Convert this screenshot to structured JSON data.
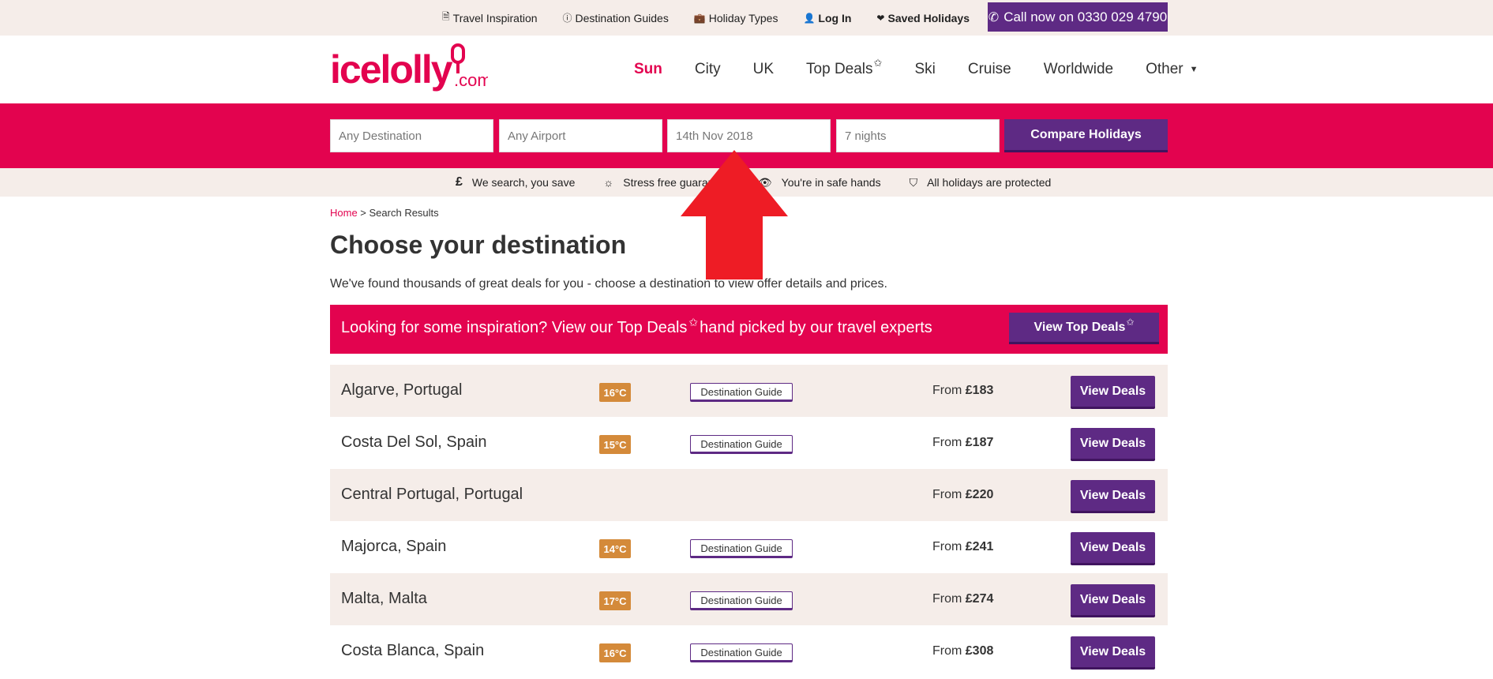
{
  "utility": {
    "links": [
      {
        "icon": "document-icon",
        "glyph": "🗎",
        "label": "Travel Inspiration"
      },
      {
        "icon": "info-icon",
        "glyph": "ⓘ",
        "label": "Destination Guides"
      },
      {
        "icon": "suitcase-icon",
        "glyph": "💼",
        "label": "Holiday Types"
      },
      {
        "icon": "user-icon",
        "glyph": "👤",
        "label": "Log In"
      },
      {
        "icon": "heart-icon",
        "glyph": "❤",
        "label": "Saved Holidays"
      }
    ],
    "call": "Call now on 0330 029 4790"
  },
  "logo": {
    "text": "icelolly",
    "suffix": ".com"
  },
  "nav": {
    "sun": "Sun",
    "city": "City",
    "uk": "UK",
    "top_deals": "Top Deals",
    "ski": "Ski",
    "cruise": "Cruise",
    "worldwide": "Worldwide",
    "other": "Other"
  },
  "search": {
    "destination": "Any Destination",
    "airport": "Any Airport",
    "date": "14th Nov 2018",
    "nights": "7 nights",
    "compare": "Compare Holidays"
  },
  "trust": [
    {
      "icon": "pound-icon",
      "glyph": "£",
      "label": "We search, you save"
    },
    {
      "icon": "sun-icon",
      "glyph": "☼",
      "label": "Stress free guarantee"
    },
    {
      "icon": "eye-icon",
      "glyph": "👁",
      "label": "You're in safe hands"
    },
    {
      "icon": "shield-icon",
      "glyph": "⛉",
      "label": "All holidays are protected"
    }
  ],
  "breadcrumb": {
    "home": "Home",
    "sep": " > ",
    "current": "Search Results"
  },
  "page": {
    "title": "Choose your destination",
    "intro": "We've found thousands of great deals for you - choose a destination to view offer details and prices."
  },
  "promo": {
    "text_before": "Looking for some inspiration? View our Top Deals",
    "text_after": "hand picked by our travel experts",
    "button": "View Top Deals"
  },
  "results": {
    "from_label": "From",
    "guide_label": "Destination Guide",
    "view_label": "View Deals",
    "rows": [
      {
        "destination": "Algarve, Portugal",
        "temp": "16°C",
        "price": "£183",
        "guide": true
      },
      {
        "destination": "Costa Del Sol, Spain",
        "temp": "15°C",
        "price": "£187",
        "guide": true
      },
      {
        "destination": "Central Portugal, Portugal",
        "temp": "",
        "price": "£220",
        "guide": false
      },
      {
        "destination": "Majorca, Spain",
        "temp": "14°C",
        "price": "£241",
        "guide": true
      },
      {
        "destination": "Malta, Malta",
        "temp": "17°C",
        "price": "£274",
        "guide": true
      },
      {
        "destination": "Costa Blanca, Spain",
        "temp": "16°C",
        "price": "£308",
        "guide": true
      }
    ]
  },
  "colors": {
    "brand": "#e3034f",
    "purple": "#5e2a84",
    "beige": "#f5ede9",
    "temp": "#d48a3a",
    "arrow": "#ee1c25"
  }
}
